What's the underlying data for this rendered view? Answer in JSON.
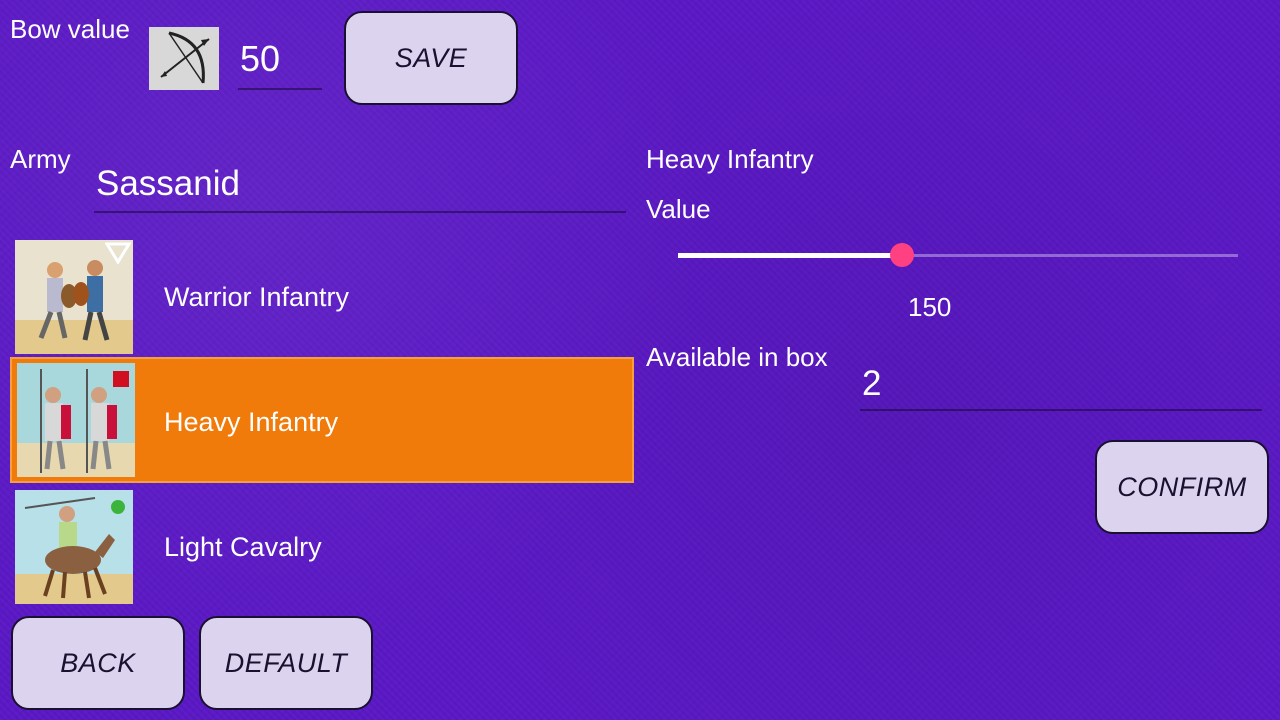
{
  "bow": {
    "label": "Bow value",
    "value": "50",
    "icon": "bow-icon"
  },
  "buttons": {
    "save": "SAVE",
    "back": "BACK",
    "default": "DEFAULT",
    "confirm": "CONFIRM"
  },
  "army": {
    "label": "Army",
    "value": "Sassanid"
  },
  "units": [
    {
      "name": "Warrior Infantry",
      "marker": "triangle",
      "selected": false
    },
    {
      "name": "Heavy Infantry",
      "marker": "square",
      "selected": true
    },
    {
      "name": "Light Cavalry",
      "marker": "circle",
      "selected": false
    }
  ],
  "detail": {
    "title": "Heavy Infantry",
    "value_label": "Value",
    "value": "150",
    "slider_fraction": 0.4,
    "available_label": "Available in box",
    "available": "2"
  },
  "colors": {
    "background": "#5a18c4",
    "selected_row": "#f07a0a",
    "slider_thumb": "#ff4081",
    "button": "#dcd3ee"
  }
}
